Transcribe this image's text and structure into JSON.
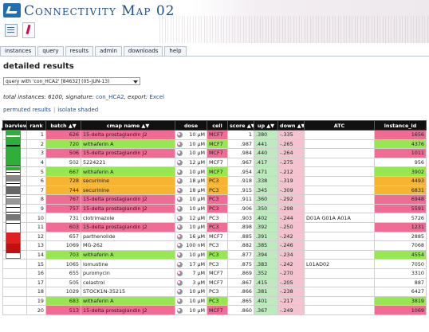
{
  "app": {
    "title": "Connectivity Map 02"
  },
  "nav": {
    "tabs": [
      "instances",
      "query",
      "results",
      "admin",
      "downloads",
      "help"
    ]
  },
  "page": {
    "section_title": "detailed results",
    "query_select": "query with 'con_HCA2' [84632] (05-JUN-13)",
    "summary_prefix": "total instances: 6100, signature: ",
    "signature_link": "con_HCA2",
    "summary_mid": ", export: ",
    "export_link": "Excel",
    "permuted_link": "permuted results",
    "separator": "|",
    "isolate_link": "isolate shaded"
  },
  "table": {
    "headers": [
      "barview",
      "rank",
      "batch ▲▼",
      "cmap name ▲▼",
      "dose",
      "cell",
      "score ▲▼",
      "up ▲▼",
      "down ▲▼",
      "ATC",
      "instance_id"
    ],
    "rows": [
      {
        "rank": "1",
        "batch": "626",
        "name": "15-delta prostaglandin J2",
        "dose": "10 µM",
        "cell": "MCF7",
        "score": "1",
        "up": ".380",
        "down": "-.335",
        "atc": "",
        "id": "1656",
        "color": "pink"
      },
      {
        "rank": "2",
        "batch": "720",
        "name": "withaferin A",
        "dose": "10 µM",
        "cell": "MCF7",
        "score": ".987",
        "up": ".441",
        "down": "-.265",
        "atc": "",
        "id": "4376",
        "color": "green"
      },
      {
        "rank": "3",
        "batch": "506",
        "name": "15-delta prostaglandin J2",
        "dose": "10 µM",
        "cell": "MCF7",
        "score": ".984",
        "up": ".440",
        "down": "-.264",
        "atc": "",
        "id": "1011",
        "color": "pink"
      },
      {
        "rank": "4",
        "batch": "502",
        "name": "5224221",
        "dose": "12 µM",
        "cell": "MCF7",
        "score": ".967",
        "up": ".417",
        "down": "-.275",
        "atc": "",
        "id": "956",
        "color": "none"
      },
      {
        "rank": "5",
        "batch": "667",
        "name": "withaferin A",
        "dose": "10 µM",
        "cell": "MCF7",
        "score": ".954",
        "up": ".471",
        "down": "-.212",
        "atc": "",
        "id": "3902",
        "color": "green"
      },
      {
        "rank": "6",
        "batch": "728",
        "name": "securinine",
        "dose": "18 µM",
        "cell": "PC3",
        "score": ".918",
        "up": ".338",
        "down": "-.319",
        "atc": "",
        "id": "4493",
        "color": "orange"
      },
      {
        "rank": "7",
        "batch": "744",
        "name": "securinine",
        "dose": "18 µM",
        "cell": "PC3",
        "score": ".915",
        "up": ".345",
        "down": "-.309",
        "atc": "",
        "id": "6831",
        "color": "orange"
      },
      {
        "rank": "8",
        "batch": "767",
        "name": "15-delta prostaglandin J2",
        "dose": "10 µM",
        "cell": "PC3",
        "score": ".911",
        "up": ".360",
        "down": "-.292",
        "atc": "",
        "id": "6948",
        "color": "pink"
      },
      {
        "rank": "9",
        "batch": "757",
        "name": "15-delta prostaglandin J2",
        "dose": "10 µM",
        "cell": "PC3",
        "score": ".906",
        "up": ".350",
        "down": "-.298",
        "atc": "",
        "id": "5591",
        "color": "pink"
      },
      {
        "rank": "10",
        "batch": "731",
        "name": "clotrimazole",
        "dose": "12 µM",
        "cell": "PC3",
        "score": ".903",
        "up": ".402",
        "down": "-.244",
        "atc": "D01A G01A A01A",
        "id": "5726",
        "color": "none"
      },
      {
        "rank": "11",
        "batch": "603",
        "name": "15-delta prostaglandin J2",
        "dose": "10 µM",
        "cell": "PC3",
        "score": ".898",
        "up": ".392",
        "down": "-.250",
        "atc": "",
        "id": "1231",
        "color": "pink"
      },
      {
        "rank": "12",
        "batch": "657",
        "name": "parthenolide",
        "dose": "16 µM",
        "cell": "MCF7",
        "score": ".885",
        "up": ".391",
        "down": "-.242",
        "atc": "",
        "id": "2885",
        "color": "none"
      },
      {
        "rank": "13",
        "batch": "1069",
        "name": "MG-262",
        "dose": "100 nM",
        "cell": "PC3",
        "score": ".882",
        "up": ".385",
        "down": "-.246",
        "atc": "",
        "id": "7068",
        "color": "none"
      },
      {
        "rank": "14",
        "batch": "703",
        "name": "withaferin A",
        "dose": "10 µM",
        "cell": "PC3",
        "score": ".877",
        "up": ".394",
        "down": "-.234",
        "atc": "",
        "id": "4554",
        "color": "green"
      },
      {
        "rank": "15",
        "batch": "1065",
        "name": "lomustine",
        "dose": "17 µM",
        "cell": "PC3",
        "score": ".875",
        "up": ".383",
        "down": "-.242",
        "atc": "L01AD02",
        "id": "7050",
        "color": "none"
      },
      {
        "rank": "16",
        "batch": "655",
        "name": "puromycin",
        "dose": "7 µM",
        "cell": "MCF7",
        "score": ".869",
        "up": ".352",
        "down": "-.270",
        "atc": "",
        "id": "3310",
        "color": "none"
      },
      {
        "rank": "17",
        "batch": "505",
        "name": "celastrol",
        "dose": "3 µM",
        "cell": "MCF7",
        "score": ".867",
        "up": ".415",
        "down": "-.205",
        "atc": "",
        "id": "887",
        "color": "none"
      },
      {
        "rank": "18",
        "batch": "1029",
        "name": "STOCK1N-35215",
        "dose": "10 µM",
        "cell": "PC3",
        "score": ".866",
        "up": ".381",
        "down": "-.238",
        "atc": "",
        "id": "6427",
        "color": "none"
      },
      {
        "rank": "19",
        "batch": "683",
        "name": "withaferin A",
        "dose": "10 µM",
        "cell": "PC3",
        "score": ".865",
        "up": ".401",
        "down": "-.217",
        "atc": "",
        "id": "3819",
        "color": "green"
      },
      {
        "rank": "20",
        "batch": "513",
        "name": "15-delta prostaglandin J2",
        "dose": "10 µM",
        "cell": "MCF7",
        "score": ".860",
        "up": ".367",
        "down": "-.249",
        "atc": "",
        "id": "1069",
        "color": "pink"
      }
    ]
  },
  "colors": {
    "green": "#95e84f",
    "pink": "#f06c95",
    "orange": "#f7b431",
    "header_bg": "#111111",
    "link": "#1f4f8a"
  },
  "icons": {
    "logo": "cmap-logo-icon",
    "list": "list-view-icon",
    "tube": "test-tube-icon",
    "compound": "compound-pill-icon"
  }
}
